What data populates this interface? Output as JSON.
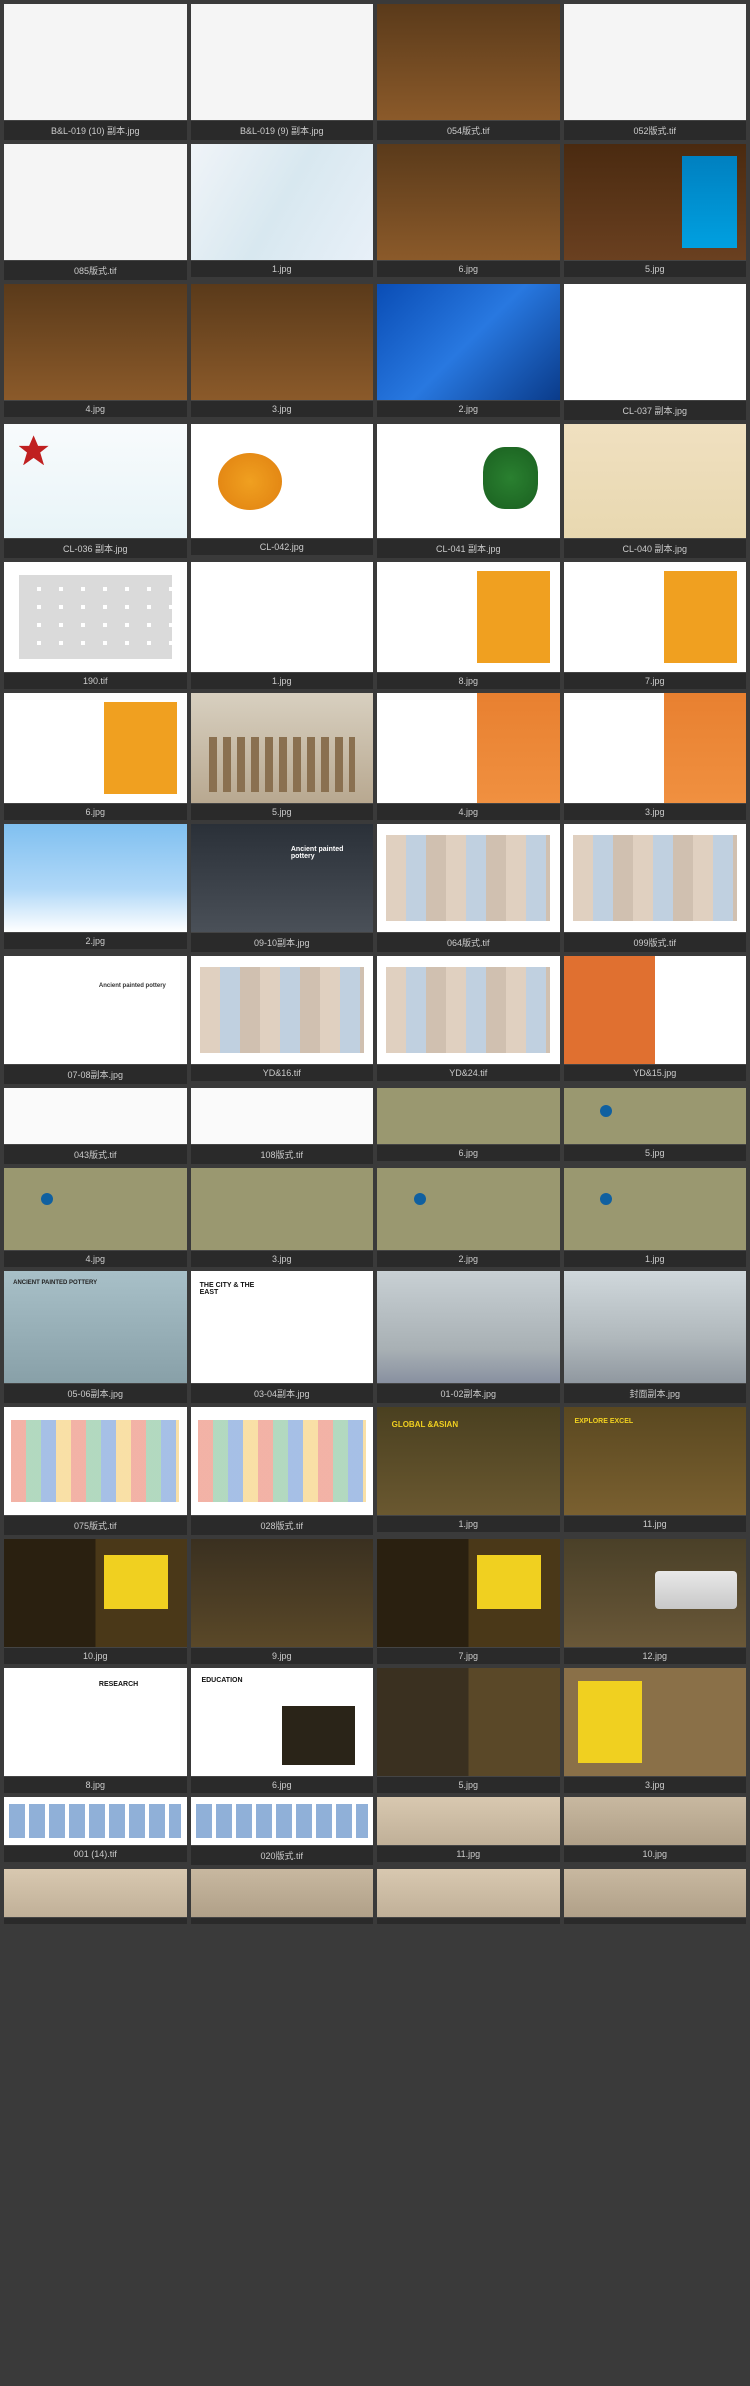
{
  "rows": [
    {
      "h": "h1",
      "items": [
        {
          "label": "B&L-019 (10) 副本.jpg",
          "art": "t-grey"
        },
        {
          "label": "B&L-019 (9) 副本.jpg",
          "art": "t-grey"
        },
        {
          "label": "054版式.tif",
          "art": "t-library"
        },
        {
          "label": "052版式.tif",
          "art": "t-grey"
        }
      ]
    },
    {
      "h": "h1",
      "items": [
        {
          "label": "085版式.tif",
          "art": "t-grey"
        },
        {
          "label": "1.jpg",
          "art": "t-poly"
        },
        {
          "label": "6.jpg",
          "art": "t-library"
        },
        {
          "label": "5.jpg",
          "art": "t-ebook"
        }
      ]
    },
    {
      "h": "h1",
      "items": [
        {
          "label": "4.jpg",
          "art": "t-library"
        },
        {
          "label": "3.jpg",
          "art": "t-library"
        },
        {
          "label": "2.jpg",
          "art": "t-blue-abs"
        },
        {
          "label": "CL-037 副本.jpg",
          "art": "t-white"
        }
      ]
    },
    {
      "h": "h2",
      "items": [
        {
          "label": "CL-036 副本.jpg",
          "art": "t-maple"
        },
        {
          "label": "CL-042.jpg",
          "art": "t-orange-flower"
        },
        {
          "label": "CL-041 副本.jpg",
          "art": "t-callig"
        },
        {
          "label": "CL-040 副本.jpg",
          "art": "t-tan-card"
        }
      ]
    },
    {
      "h": "h3",
      "items": [
        {
          "label": "190.tif",
          "art": "t-grid-thumbs"
        },
        {
          "label": "1.jpg",
          "art": "t-white"
        },
        {
          "label": "8.jpg",
          "art": "t-layout-yellow"
        },
        {
          "label": "7.jpg",
          "art": "t-layout-yellow"
        }
      ]
    },
    {
      "h": "h3",
      "items": [
        {
          "label": "6.jpg",
          "art": "t-layout-yellow"
        },
        {
          "label": "5.jpg",
          "art": "t-towers"
        },
        {
          "label": "4.jpg",
          "art": "t-orange-block"
        },
        {
          "label": "3.jpg",
          "art": "t-orange-block"
        }
      ]
    },
    {
      "h": "h4",
      "items": [
        {
          "label": "2.jpg",
          "art": "t-sky-blue"
        },
        {
          "label": "09-10副本.jpg",
          "art": "t-pottery"
        },
        {
          "label": "064版式.tif",
          "art": "t-collage"
        },
        {
          "label": "099版式.tif",
          "art": "t-collage"
        }
      ]
    },
    {
      "h": "h4",
      "items": [
        {
          "label": "07-08副本.jpg",
          "art": "t-pottery-white"
        },
        {
          "label": "YD&16.tif",
          "art": "t-collage"
        },
        {
          "label": "YD&24.tif",
          "art": "t-collage"
        },
        {
          "label": "YD&15.jpg",
          "art": "t-orange-collage"
        }
      ]
    },
    {
      "h": "h5",
      "items": [
        {
          "label": "043版式.tif",
          "art": "t-wide-light"
        },
        {
          "label": "108版式.tif",
          "art": "t-wide-light"
        },
        {
          "label": "6.jpg",
          "art": "t-olive"
        },
        {
          "label": "5.jpg",
          "art": "t-olive-dots"
        }
      ]
    },
    {
      "h": "h6",
      "items": [
        {
          "label": "4.jpg",
          "art": "t-olive-dots"
        },
        {
          "label": "3.jpg",
          "art": "t-olive"
        },
        {
          "label": "2.jpg",
          "art": "t-olive-dots"
        },
        {
          "label": "1.jpg",
          "art": "t-olive-dots"
        }
      ]
    },
    {
      "h": "h8",
      "items": [
        {
          "label": "05-06副本.jpg",
          "art": "t-pyramid"
        },
        {
          "label": "03-04副本.jpg",
          "art": "t-east"
        },
        {
          "label": "01-02副本.jpg",
          "art": "t-sea"
        },
        {
          "label": "封面副本.jpg",
          "art": "t-sea-wave"
        }
      ]
    },
    {
      "h": "h4",
      "items": [
        {
          "label": "075版式.tif",
          "art": "t-colorful"
        },
        {
          "label": "028版式.tif",
          "art": "t-colorful"
        },
        {
          "label": "1.jpg",
          "art": "t-global"
        },
        {
          "label": "11.jpg",
          "art": "t-explore"
        }
      ]
    },
    {
      "h": "h4",
      "items": [
        {
          "label": "10.jpg",
          "art": "t-yellow-dark"
        },
        {
          "label": "9.jpg",
          "art": "t-hands"
        },
        {
          "label": "7.jpg",
          "art": "t-yellow-dark"
        },
        {
          "label": "12.jpg",
          "art": "t-yacht"
        }
      ]
    },
    {
      "h": "h4",
      "items": [
        {
          "label": "8.jpg",
          "art": "t-research"
        },
        {
          "label": "6.jpg",
          "art": "t-education"
        },
        {
          "label": "5.jpg",
          "art": "t-community"
        },
        {
          "label": "3.jpg",
          "art": "t-pattern"
        }
      ]
    },
    {
      "h": "h7",
      "items": [
        {
          "label": "001 (14).tif",
          "art": "t-blue-strip"
        },
        {
          "label": "020版式.tif",
          "art": "t-blue-strip"
        },
        {
          "label": "11.jpg",
          "art": "t-fashion"
        },
        {
          "label": "10.jpg",
          "art": "t-fashion2"
        }
      ]
    },
    {
      "h": "h7",
      "items": [
        {
          "label": "",
          "art": "t-fashion"
        },
        {
          "label": "",
          "art": "t-fashion2"
        },
        {
          "label": "",
          "art": "t-fashion"
        },
        {
          "label": "",
          "art": "t-fashion2"
        }
      ]
    }
  ]
}
